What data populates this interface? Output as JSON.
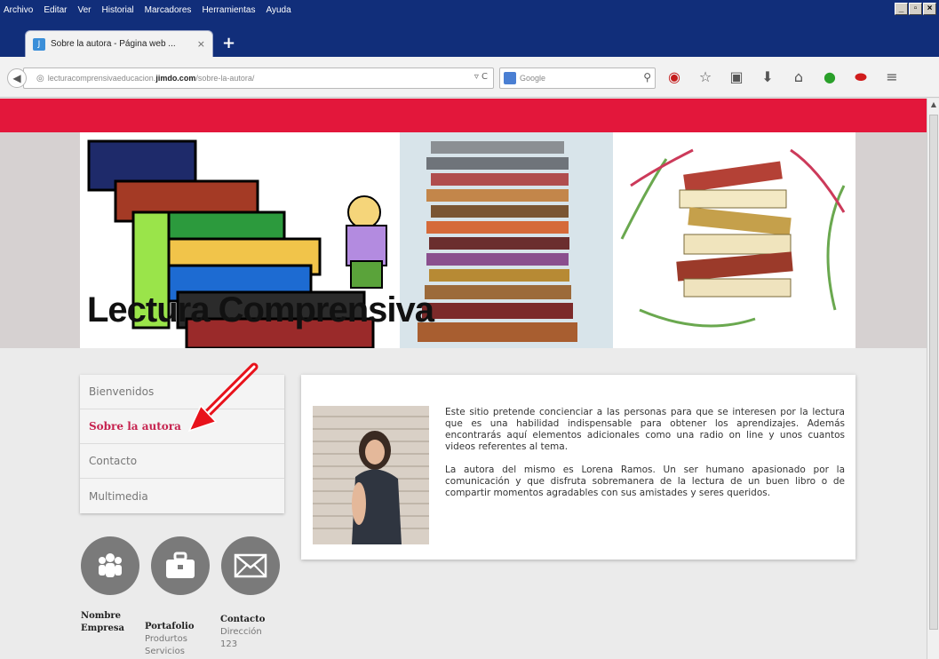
{
  "browser": {
    "menu": [
      "Archivo",
      "Editar",
      "Ver",
      "Historial",
      "Marcadores",
      "Herramientas",
      "Ayuda"
    ],
    "window_buttons": [
      "_",
      "▫",
      "×"
    ],
    "tab": {
      "title": "Sobre la autora - Página web ...",
      "close": "×",
      "new": "+"
    },
    "url": {
      "prefix": "lecturacomprensivaeducacion.",
      "domain": "jimdo.com",
      "path": "/sobre-la-autora/"
    },
    "search_placeholder": "Google",
    "toolbar_icons": [
      "record-icon",
      "star-icon",
      "clipboard-icon",
      "download-icon",
      "home-icon",
      "extension-icon",
      "addon-icon",
      "menu-icon"
    ]
  },
  "site": {
    "title": "Lectura Comprensiva",
    "colors": {
      "accent": "#e3173b",
      "active_menu": "#c6234f"
    },
    "nav": [
      {
        "label": "Bienvenidos",
        "active": false
      },
      {
        "label": "Sobre la autora",
        "active": true
      },
      {
        "label": "Contacto",
        "active": false
      },
      {
        "label": "Multimedia",
        "active": false
      }
    ],
    "icons": [
      "people-icon",
      "briefcase-icon",
      "envelope-icon"
    ],
    "footer": {
      "col1": {
        "heading": "Nombre Empresa"
      },
      "col2": {
        "heading": "Portafolio",
        "line1": "Produrtos",
        "line2": "Servicios"
      },
      "col3": {
        "heading": "Contacto",
        "line1": "Dirección",
        "line2": "123"
      }
    },
    "content": {
      "p1": "Este sitio pretende concienciar a las personas para que se interesen por la lectura que es una habilidad indispensable para obtener los aprendizajes. Además encontrarás aquí elementos adicionales como una radio on line y unos cuantos videos referentes al tema.",
      "p2": "La autora del mismo es Lorena Ramos. Un ser humano apasionado por la comunicación y que disfruta sobremanera de la lectura de un buen libro o de compartir momentos agradables con sus amistades y seres queridos."
    }
  }
}
